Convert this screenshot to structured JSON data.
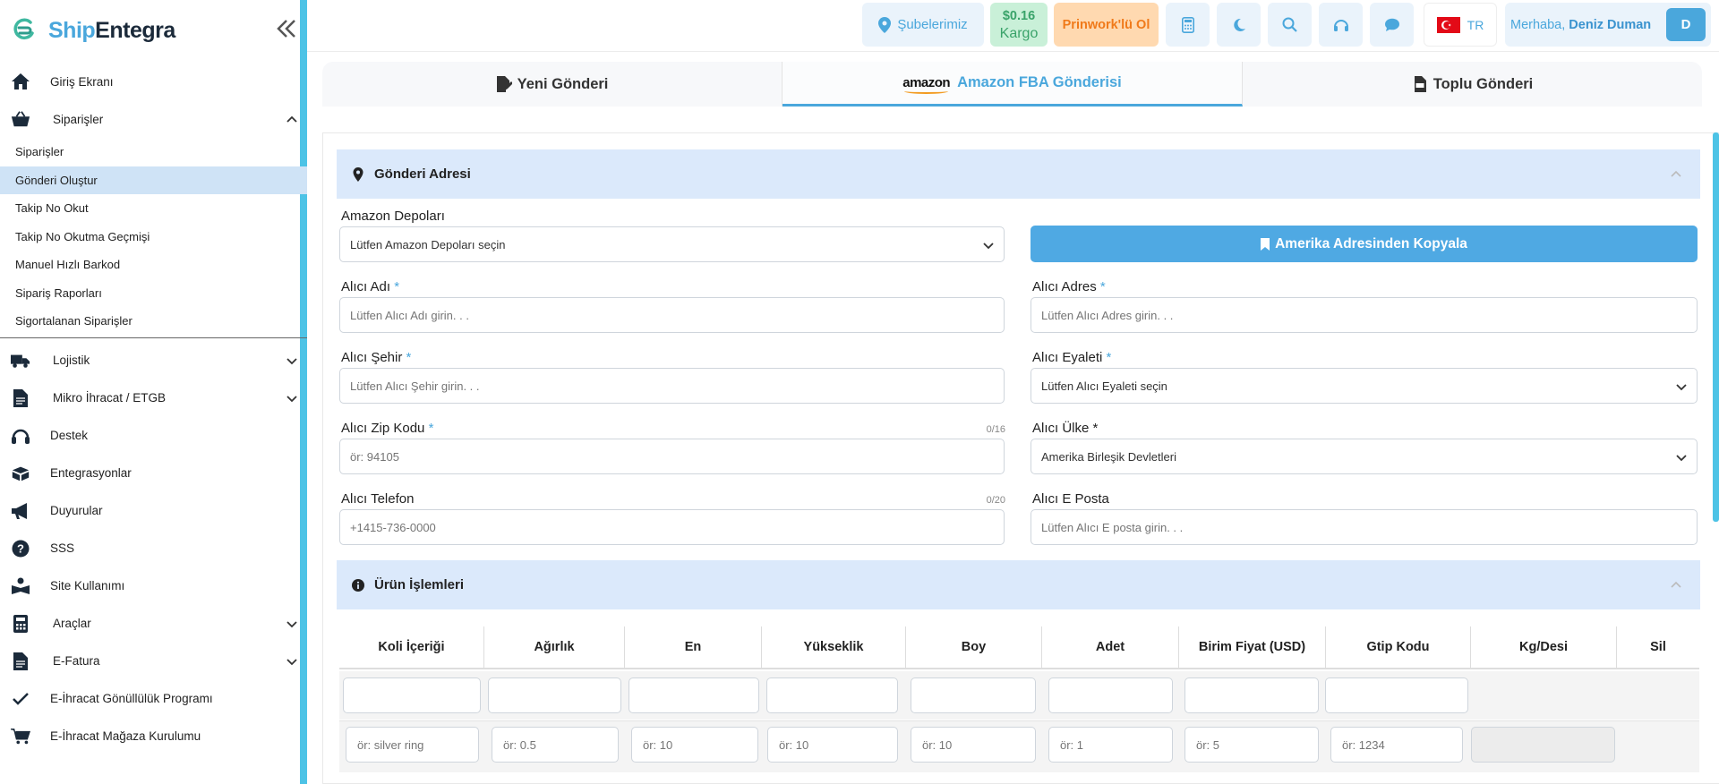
{
  "brand": {
    "part1": "Ship",
    "part2": "Entegra"
  },
  "sidebar": {
    "items": [
      {
        "label": "Giriş Ekranı",
        "icon": "home-icon"
      },
      {
        "label": "Siparişler",
        "icon": "basket-icon",
        "expanded": true
      },
      {
        "label": "Lojistik",
        "icon": "truck-icon"
      },
      {
        "label": "Mikro İhracat / ETGB",
        "icon": "document-icon"
      },
      {
        "label": "Destek",
        "icon": "headset-icon"
      },
      {
        "label": "Entegrasyonlar",
        "icon": "box-open-icon"
      },
      {
        "label": "Duyurular",
        "icon": "megaphone-icon"
      },
      {
        "label": "SSS",
        "icon": "question-icon"
      },
      {
        "label": "Site Kullanımı",
        "icon": "reading-icon"
      },
      {
        "label": "Araçlar",
        "icon": "calculator-icon"
      },
      {
        "label": "E-Fatura",
        "icon": "invoice-icon"
      },
      {
        "label": "E-İhracat Gönüllülük Programı",
        "icon": "check-icon"
      },
      {
        "label": "E-İhracat Mağaza Kurulumu",
        "icon": "cart-icon"
      }
    ],
    "sub_items": [
      "Siparişler",
      "Gönderi Oluştur",
      "Takip No Okut",
      "Takip No Okutma Geçmişi",
      "Manuel Hızlı Barkod",
      "Sipariş Raporları",
      "Sigortalanan Siparişler"
    ],
    "active_sub": "Gönderi Oluştur"
  },
  "topbar": {
    "branches": "Şubelerimiz",
    "price_value": "$0.16",
    "price_label": "Kargo",
    "promo": "Prinwork'lü Ol",
    "lang": "TR",
    "greeting": "Merhaba,",
    "user_name": "Deniz Duman",
    "avatar_letter": "D"
  },
  "tabs": [
    {
      "label": "Yeni Gönderi"
    },
    {
      "label": "Amazon FBA Gönderisi",
      "logo_text": "amazon",
      "active": true
    },
    {
      "label": "Toplu Gönderi"
    }
  ],
  "address_section": {
    "title": "Gönderi Adresi",
    "warehouse_label": "Amazon Depoları",
    "warehouse_value": "Lütfen Amazon Depoları seçin",
    "copy_button": "Amerika Adresinden Kopyala",
    "name_label": "Alıcı Adı",
    "name_placeholder": "Lütfen Alıcı Adı girin. . .",
    "address_label": "Alıcı Adres",
    "address_placeholder": "Lütfen Alıcı Adres girin. . .",
    "city_label": "Alıcı Şehir",
    "city_placeholder": "Lütfen Alıcı Şehir girin. . .",
    "state_label": "Alıcı Eyaleti",
    "state_value": "Lütfen Alıcı Eyaleti seçin",
    "zip_label": "Alıcı Zip Kodu",
    "zip_counter": "0/16",
    "zip_placeholder": "ör: 94105",
    "country_label": "Alıcı Ülke *",
    "country_value": "Amerika Birleşik Devletleri",
    "phone_label": "Alıcı Telefon",
    "phone_counter": "0/20",
    "phone_placeholder": "+1415-736-0000",
    "email_label": "Alıcı E Posta",
    "email_placeholder": "Lütfen Alıcı E posta girin. . .",
    "required_mark": "*"
  },
  "product_section": {
    "title": "Ürün İşlemleri",
    "columns": [
      "Koli İçeriği",
      "Ağırlık",
      "En",
      "Yükseklik",
      "Boy",
      "Adet",
      "Birim Fiyat (USD)",
      "Gtip Kodu",
      "Kg/Desi",
      "Sil"
    ],
    "row_placeholders": [
      "ör: silver ring",
      "ör: 0.5",
      "ör: 10",
      "ör: 10",
      "ör: 10",
      "ör: 1",
      "ör: 5",
      "ör: 1234"
    ]
  }
}
